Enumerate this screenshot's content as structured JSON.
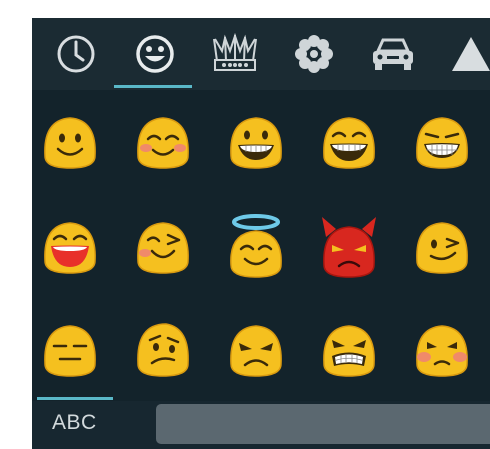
{
  "keyboard": {
    "tabs": [
      {
        "name": "recent-clock-icon"
      },
      {
        "name": "smiley-face-icon",
        "active": true
      },
      {
        "name": "crown-icon"
      },
      {
        "name": "flower-icon"
      },
      {
        "name": "car-icon"
      },
      {
        "name": "triangle-symbol-icon"
      }
    ],
    "emojis": [
      [
        "smiling-face",
        "blushing-smile",
        "grinning-face",
        "beaming-grin",
        "grimacing-grin"
      ],
      [
        "laughing-face",
        "winking-squint-face",
        "smiling-face-with-halo",
        "angry-devil-face",
        "winking-face"
      ],
      [
        "expressionless-face",
        "confused-face",
        "frowning-angry-face",
        "grimacing-angry-face",
        "pouting-blush-face"
      ]
    ],
    "bottom": {
      "abc_label": "ABC"
    },
    "colors": {
      "background": "#13232b",
      "tab_bar": "#1b2b33",
      "accent": "#5ab8c8",
      "emoji_yellow": "#f5c01f",
      "devil_red": "#d8271f",
      "spacebar": "#5b6870"
    }
  }
}
